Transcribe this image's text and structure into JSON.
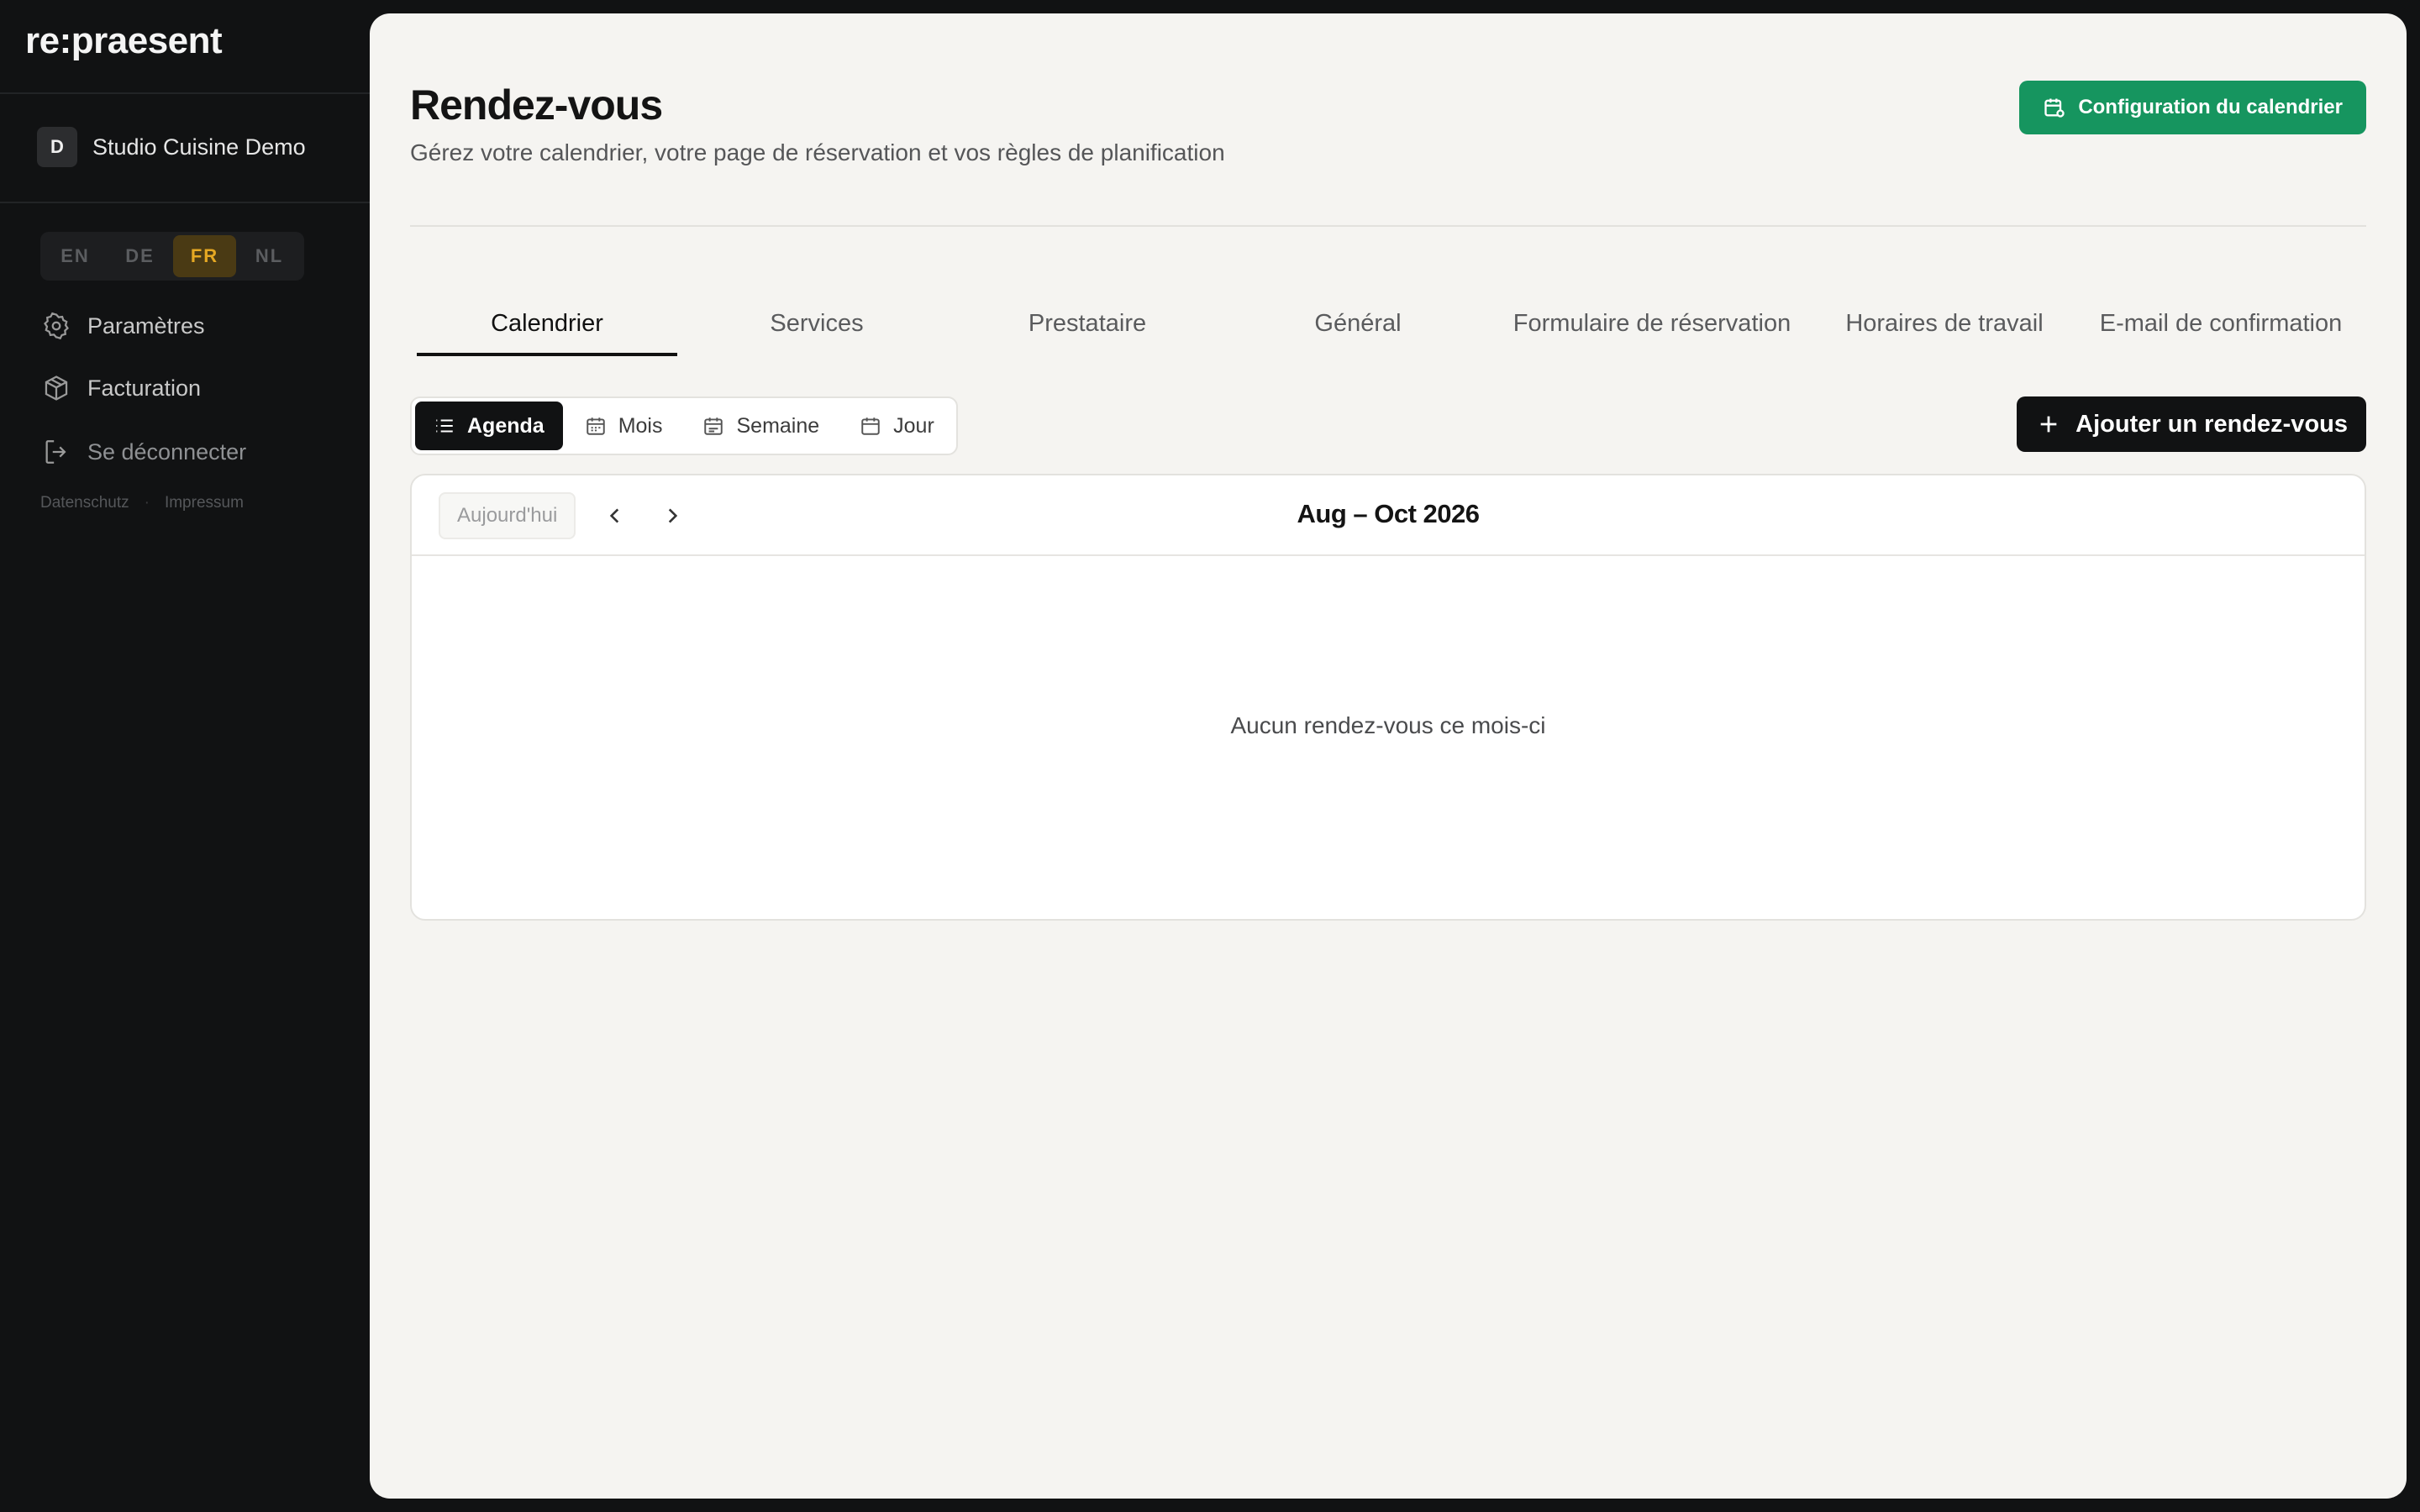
{
  "brand": {
    "logo": "re:praesent"
  },
  "organization": {
    "initial": "D",
    "name": "Studio Cuisine Demo"
  },
  "languages": [
    {
      "code": "EN",
      "active": false
    },
    {
      "code": "DE",
      "active": false
    },
    {
      "code": "FR",
      "active": true
    },
    {
      "code": "NL",
      "active": false
    }
  ],
  "sidebar": {
    "items": [
      {
        "label": "Paramètres",
        "icon": "gear-icon"
      },
      {
        "label": "Facturation",
        "icon": "box-icon"
      },
      {
        "label": "Se déconnecter",
        "icon": "logout-icon"
      }
    ],
    "legal": {
      "privacy": "Datenschutz",
      "imprint": "Impressum",
      "separator": "·"
    }
  },
  "page": {
    "title": "Rendez-vous",
    "subtitle": "Gérez votre calendrier, votre page de réservation et vos règles de planification",
    "config_button": "Configuration du calendrier"
  },
  "tabs": [
    {
      "label": "Calendrier",
      "active": true
    },
    {
      "label": "Services",
      "active": false
    },
    {
      "label": "Prestataire",
      "active": false
    },
    {
      "label": "Général",
      "active": false
    },
    {
      "label": "Formulaire de réservation",
      "active": false
    },
    {
      "label": "Horaires de travail",
      "active": false
    },
    {
      "label": "E-mail de confirmation",
      "active": false
    }
  ],
  "views": [
    {
      "label": "Agenda",
      "icon": "list-icon",
      "active": true
    },
    {
      "label": "Mois",
      "icon": "calendar-icon",
      "active": false
    },
    {
      "label": "Semaine",
      "icon": "calendar-week-icon",
      "active": false
    },
    {
      "label": "Jour",
      "icon": "calendar-day-icon",
      "active": false
    }
  ],
  "add_button": "Ajouter un rendez-vous",
  "calendar": {
    "today_button": "Aujourd'hui",
    "range": "Aug – Oct 2026",
    "empty_message": "Aucun rendez-vous ce mois-ci"
  },
  "colors": {
    "accent_green": "#16955f",
    "lang_active": "#e5a823",
    "dark": "#111213",
    "panel_bg": "#f5f4f1"
  }
}
